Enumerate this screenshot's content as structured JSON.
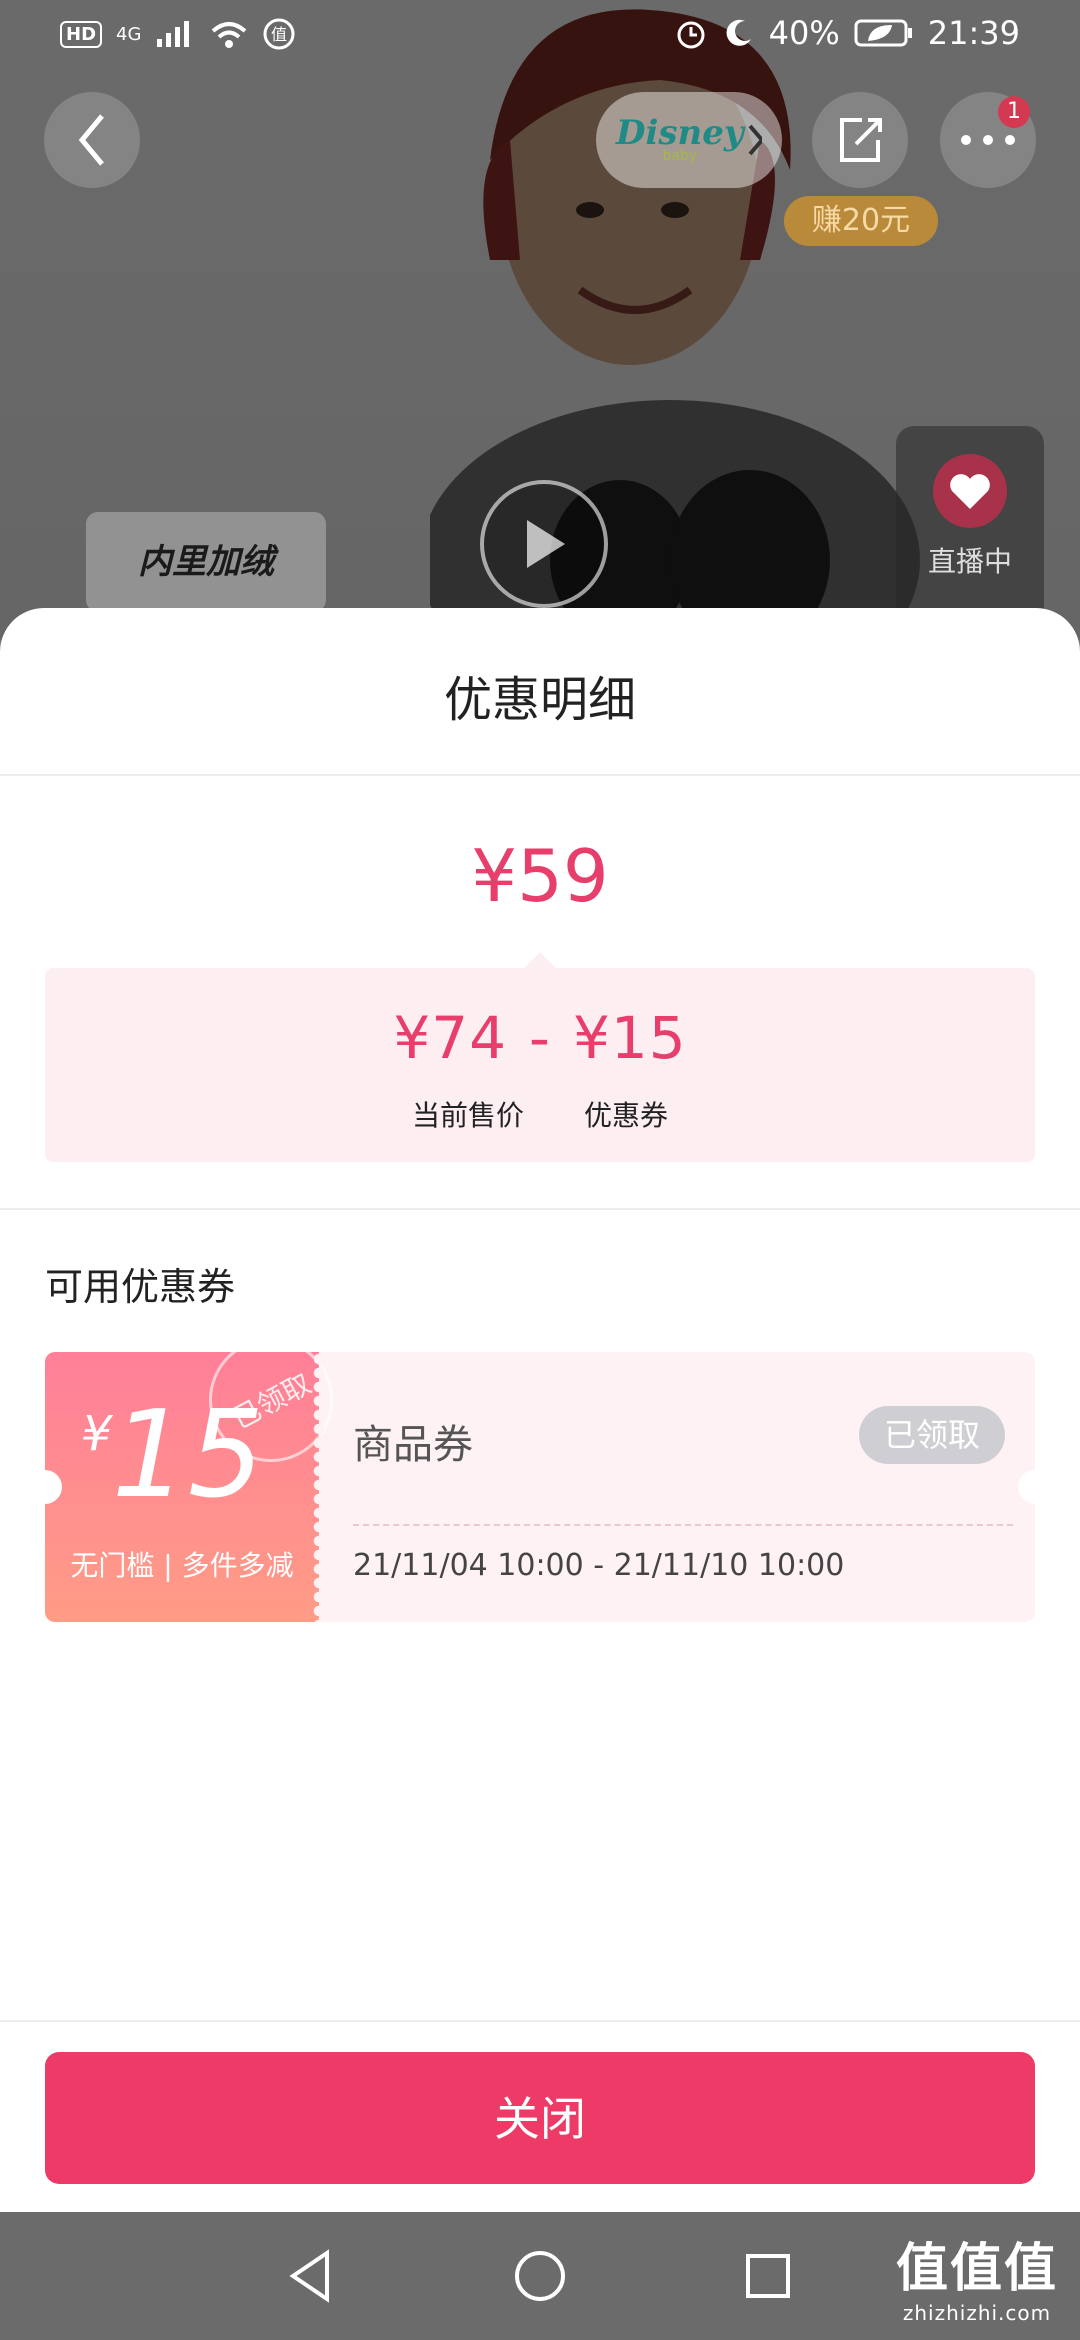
{
  "status_bar": {
    "hd": "HD",
    "network": "4G",
    "battery": "40%",
    "time": "21:39"
  },
  "header": {
    "back_icon": "chevron-left-icon",
    "brand_name": "Disney",
    "brand_sub": "baby",
    "share_icon": "share-icon",
    "more_icon": "more-dots-icon",
    "notification_count": "1",
    "earn_tag": "赚20元"
  },
  "media": {
    "feature_tag": "内里加绒",
    "live_label": "直播中"
  },
  "sheet": {
    "title": "优惠明细",
    "final_price": "¥59",
    "calculation": {
      "current_price": "¥74",
      "minus": "-",
      "coupon_value": "¥15",
      "current_price_label": "当前售价",
      "coupon_label": "优惠券"
    },
    "available_coupons_label": "可用优惠券",
    "coupons": [
      {
        "currency": "¥",
        "amount": "15",
        "condition": "无门槛 | 多件多减",
        "stamp": "已领取",
        "name": "商品券",
        "status": "已领取",
        "validity": "21/11/04 10:00 - 21/11/10 10:00"
      }
    ],
    "close_label": "关闭"
  },
  "watermark": {
    "text": "值值值",
    "url": "zhizhizhi.com"
  },
  "colors": {
    "accent": "#ee3a66",
    "price": "#e83e6c",
    "coupon_bg": "#fff2f4"
  }
}
